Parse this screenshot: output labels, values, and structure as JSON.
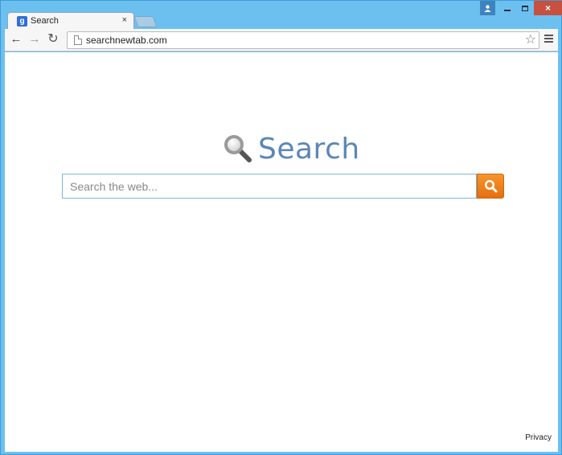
{
  "tab": {
    "title": "Search",
    "favicon_letter": "g"
  },
  "toolbar": {
    "url": "searchnewtab.com"
  },
  "page": {
    "logo_text": "Search",
    "search_placeholder": "Search the web...",
    "privacy_link": "Privacy"
  },
  "window_buttons": {
    "close": "×"
  },
  "colors": {
    "accent_orange": "#f08a1c",
    "logo_blue": "#5b86b8",
    "frame_blue": "#6cc0f0",
    "close_red": "#c7503f"
  },
  "icons": [
    "favicon-icon",
    "tab-close-icon",
    "back-icon",
    "forward-icon",
    "reload-icon",
    "page-icon",
    "star-icon",
    "menu-icon",
    "magnifier-logo-icon",
    "search-icon",
    "profile-icon"
  ]
}
